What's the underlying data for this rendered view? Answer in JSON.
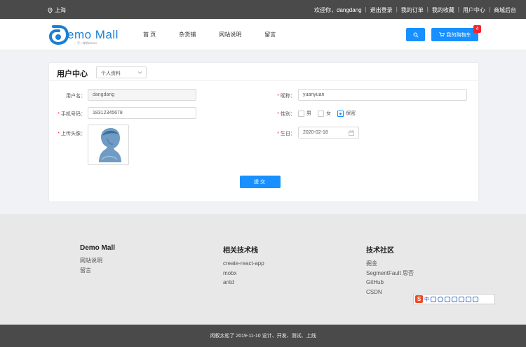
{
  "topbar": {
    "location": "上海",
    "links": [
      "欢迎你，dangdang",
      "退出登录",
      "我的订单",
      "我的收藏",
      "用户中心",
      "商城后台"
    ]
  },
  "header": {
    "logo_text": "emo Mall",
    "logo_sub": "不一样的DEMO",
    "nav": [
      "首 页",
      "杂货铺",
      "网站说明",
      "留言"
    ],
    "cart_label": "我的购物车",
    "cart_count": "4"
  },
  "profile": {
    "title": "用户中心",
    "section_select": "个人资料",
    "username_label": "用户名：",
    "username_value": "dangdang",
    "nickname_label": "昵称：",
    "nickname_value": "yuanyuan",
    "phone_label": "手机号码：",
    "phone_value": "18312345678",
    "gender_label": "性别：",
    "gender_options": [
      "男",
      "女",
      "保密"
    ],
    "gender_selected": "保密",
    "avatar_label": "上传头像：",
    "birthday_label": "生日：",
    "birthday_value": "2020-02-18",
    "submit_label": "提交"
  },
  "footer": {
    "columns": [
      {
        "title": "Demo Mall",
        "items": [
          "网站说明",
          "留言"
        ]
      },
      {
        "title": "相关技术栈",
        "items": [
          "create-react-app",
          "mobx",
          "antd"
        ]
      },
      {
        "title": "技术社区",
        "items": [
          "掘金",
          "SegmentFault 思否",
          "GitHub",
          "CSDN"
        ]
      }
    ],
    "ime": {
      "label": "中"
    },
    "copyright": "闲叙太松了 2019-11-10 设计、开发、测试、上线"
  },
  "colors": {
    "accent": "#1890ff",
    "topbar": "#4a4a4a",
    "badge": "#f5222d"
  }
}
